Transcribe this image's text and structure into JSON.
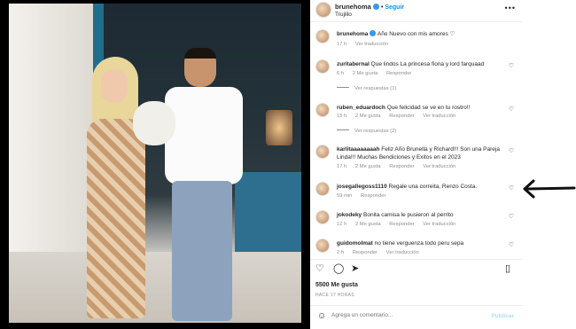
{
  "post": {
    "username": "brunehoma",
    "follow_label": "Seguir",
    "location": "Trujillo",
    "caption_user": "brunehoma",
    "caption_text": "Año Nuevo con mis amores ♡",
    "caption_time": "17 h",
    "caption_translate": "Ver traducción",
    "likes": "5500 Me gusta",
    "when": "HACE 17 HORAS"
  },
  "comments": [
    {
      "user": "zuritabernal",
      "text": "Que lindos La princesa fiona y lord farquaad",
      "time": "6 h",
      "likes": "2 Me gusta",
      "reply": "Responder",
      "translate": "",
      "replies": "Ver respuestas (1)"
    },
    {
      "user": "ruben_eduardoch",
      "text": "Que felicidad se ve en tu rostro!!",
      "time": "15 h",
      "likes": "2 Me gusta",
      "reply": "Responder",
      "translate": "Ver traducción",
      "replies": "Ver respuestas (2)"
    },
    {
      "user": "karlitaaaaaaaah",
      "text": "Feliz Año Brunella y Richard!!! Son una Pareja Linda!!! Muchas Bendiciones y Exitos en el 2023",
      "time": "17 h",
      "likes": "2 Me gusta",
      "reply": "Responder",
      "translate": "Ver traducción",
      "replies": ""
    },
    {
      "user": "josegallegoss1110",
      "text": "Regale una correita, Renzo Costa.",
      "time": "59 min",
      "likes": "",
      "reply": "Responder",
      "translate": "",
      "replies": ""
    },
    {
      "user": "jokodeky",
      "text": "Bonita camisa le pusieron al perrito",
      "time": "12 h",
      "likes": "2 Me gusta",
      "reply": "Responder",
      "translate": "Ver traducción",
      "replies": ""
    },
    {
      "user": "guidomolmat",
      "text": "no tiene verguenza todo peru sepa",
      "time": "2 h",
      "likes": "",
      "reply": "Responder",
      "translate": "Ver traducción",
      "replies": ""
    }
  ],
  "add_comment": {
    "placeholder": "Agrega un comentario...",
    "publish": "Publicar"
  },
  "icons": {
    "heart": "heart-icon",
    "comment": "comment-icon",
    "share": "share-icon",
    "save": "bookmark-icon",
    "more": "more-icon",
    "emoji": "emoji-icon"
  }
}
